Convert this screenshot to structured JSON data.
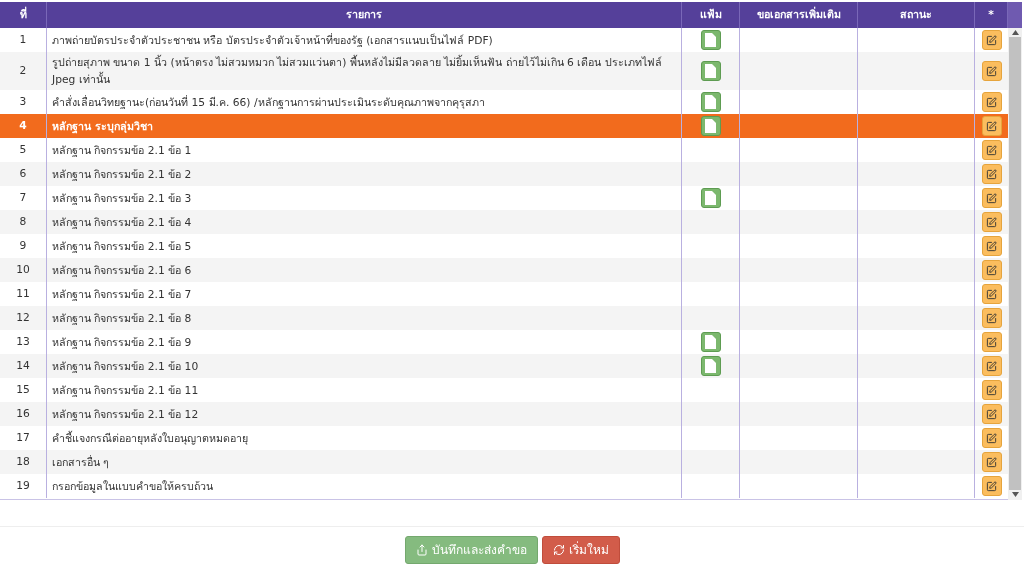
{
  "table": {
    "columns": [
      "ที่",
      "รายการ",
      "แฟ้ม",
      "ขอเอกสารเพิ่มเติม",
      "สถานะ",
      "*"
    ],
    "rows": [
      {
        "no": "1",
        "item": "ภาพถ่ายบัตรประจำตัวประชาชน หรือ บัตรประจำตัวเจ้าหน้าที่ของรัฐ (เอกสารแนบเป็นไฟล์ PDF)",
        "has_file": true,
        "selected": false
      },
      {
        "no": "2",
        "item": "รูปถ่ายสุภาพ ขนาด 1 นิ้ว (หน้าตรง ไม่สวมหมวก ไม่สวมแว่นตา) พื้นหลังไม่มีลวดลาย ไม่ยิ้มเห็นฟัน ถ่ายไว้ไม่เกิน 6 เดือน ประเภทไฟล์ Jpeg เท่านั้น",
        "has_file": true,
        "selected": false
      },
      {
        "no": "3",
        "item": "คำสั่งเลื่อนวิทยฐานะ(ก่อนวันที่ 15 มี.ค. 66) /หลักฐานการผ่านประเมินระดับคุณภาพจากคุรุสภา",
        "has_file": true,
        "selected": false
      },
      {
        "no": "4",
        "item": "หลักฐาน ระบุกลุ่มวิชา",
        "has_file": true,
        "selected": true
      },
      {
        "no": "5",
        "item": "หลักฐาน กิจกรรมข้อ 2.1 ข้อ 1",
        "has_file": false,
        "selected": false
      },
      {
        "no": "6",
        "item": "หลักฐาน กิจกรรมข้อ 2.1 ข้อ 2",
        "has_file": false,
        "selected": false
      },
      {
        "no": "7",
        "item": "หลักฐาน กิจกรรมข้อ 2.1 ข้อ 3",
        "has_file": true,
        "selected": false
      },
      {
        "no": "8",
        "item": "หลักฐาน กิจกรรมข้อ 2.1 ข้อ 4",
        "has_file": false,
        "selected": false
      },
      {
        "no": "9",
        "item": "หลักฐาน กิจกรรมข้อ 2.1 ข้อ 5",
        "has_file": false,
        "selected": false
      },
      {
        "no": "10",
        "item": "หลักฐาน กิจกรรมข้อ 2.1 ข้อ 6",
        "has_file": false,
        "selected": false
      },
      {
        "no": "11",
        "item": "หลักฐาน กิจกรรมข้อ 2.1 ข้อ 7",
        "has_file": false,
        "selected": false
      },
      {
        "no": "12",
        "item": "หลักฐาน กิจกรรมข้อ 2.1 ข้อ 8",
        "has_file": false,
        "selected": false
      },
      {
        "no": "13",
        "item": "หลักฐาน กิจกรรมข้อ 2.1 ข้อ 9",
        "has_file": true,
        "selected": false
      },
      {
        "no": "14",
        "item": "หลักฐาน กิจกรรมข้อ 2.1 ข้อ 10",
        "has_file": true,
        "selected": false
      },
      {
        "no": "15",
        "item": "หลักฐาน กิจกรรมข้อ 2.1 ข้อ 11",
        "has_file": false,
        "selected": false
      },
      {
        "no": "16",
        "item": "หลักฐาน กิจกรรมข้อ 2.1 ข้อ 12",
        "has_file": false,
        "selected": false
      },
      {
        "no": "17",
        "item": "คำชี้แจงกรณีต่ออายุหลังใบอนุญาตหมดอายุ",
        "has_file": false,
        "selected": false
      },
      {
        "no": "18",
        "item": "เอกสารอื่น ๆ",
        "has_file": false,
        "selected": false
      },
      {
        "no": "19",
        "item": "กรอกข้อมูลในแบบคำขอให้ครบถ้วน",
        "has_file": false,
        "selected": false
      }
    ]
  },
  "buttons": [
    {
      "kind": "save",
      "label": "บันทึกและส่งคำขอ"
    },
    {
      "kind": "reset",
      "label": "เริ่มใหม่"
    }
  ]
}
